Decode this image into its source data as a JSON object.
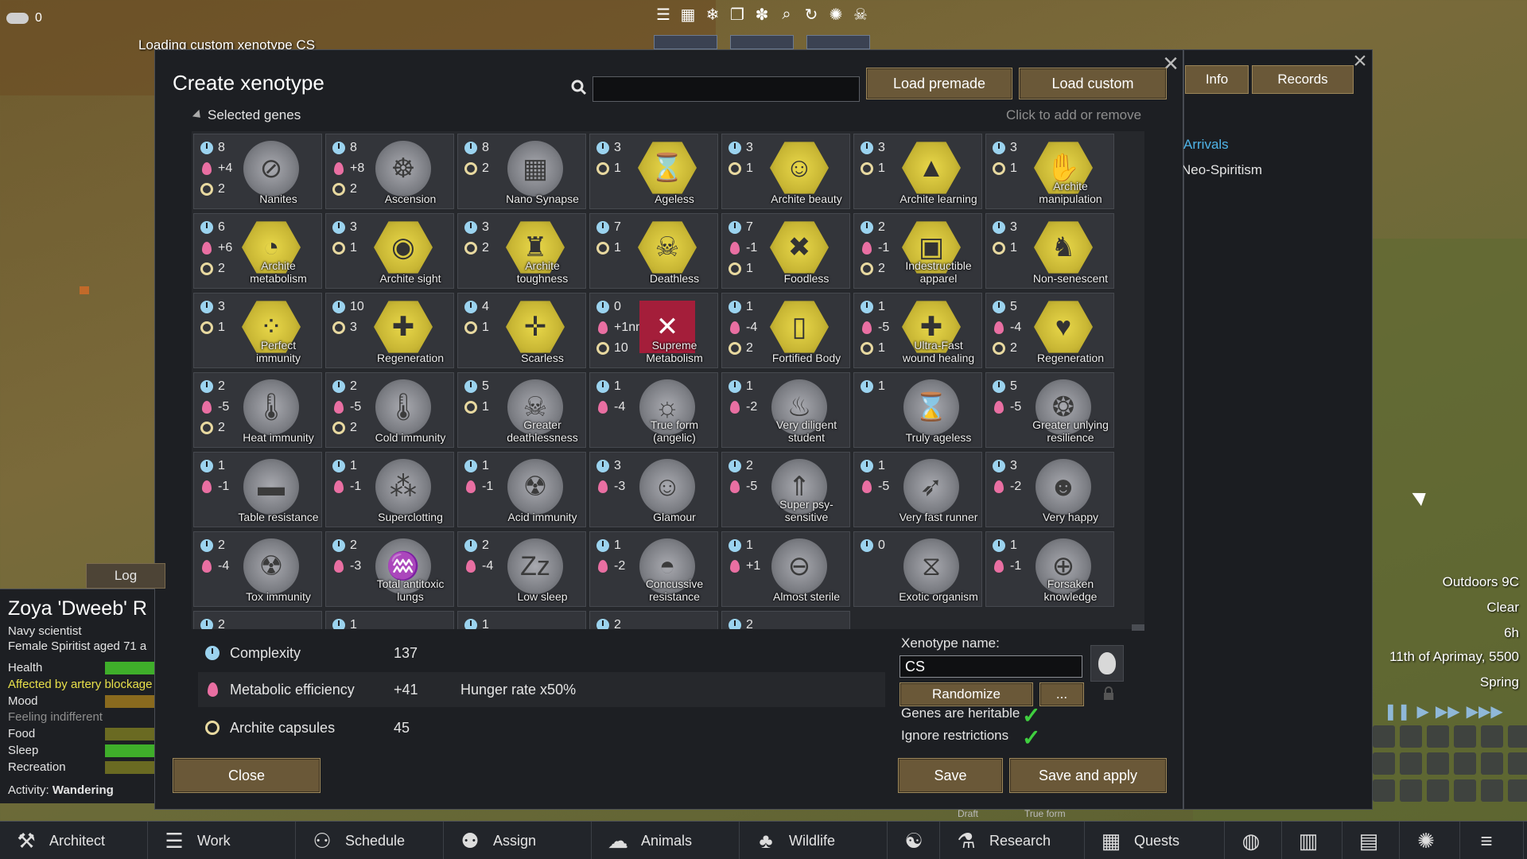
{
  "hud": {
    "silver_count": "0",
    "loading_message": "Loading custom xenotype CS"
  },
  "dialog": {
    "title": "Create xenotype",
    "search_value": "",
    "load_premade": "Load premade",
    "load_custom": "Load custom",
    "selected_genes_label": "Selected genes",
    "click_hint": "Click to add or remove",
    "genes": [
      {
        "cx": "8",
        "met": "+4",
        "arc": "2",
        "name": "Nanites",
        "icon": "nanites-icon",
        "style": "grey",
        "glyph": "⊘"
      },
      {
        "cx": "8",
        "met": "+8",
        "arc": "2",
        "name": "Ascension",
        "icon": "ascension-icon",
        "style": "grey",
        "glyph": "☸"
      },
      {
        "cx": "8",
        "met": "",
        "arc": "2",
        "name": "Nano Synapse",
        "icon": "nano-synapse-icon",
        "style": "grey",
        "glyph": "▦"
      },
      {
        "cx": "3",
        "met": "",
        "arc": "1",
        "name": "Ageless",
        "icon": "hourglass-icon",
        "style": "gold",
        "glyph": "⌛"
      },
      {
        "cx": "3",
        "met": "",
        "arc": "1",
        "name": "Archite beauty",
        "icon": "archite-beauty-icon",
        "style": "gold",
        "glyph": "☺"
      },
      {
        "cx": "3",
        "met": "",
        "arc": "1",
        "name": "Archite learning",
        "icon": "archite-learning-icon",
        "style": "gold",
        "glyph": "▲"
      },
      {
        "cx": "3",
        "met": "",
        "arc": "1",
        "name": "Archite manipulation",
        "icon": "hand-icon",
        "style": "gold",
        "glyph": "✋"
      },
      {
        "cx": "6",
        "met": "+6",
        "arc": "2",
        "name": "Archite metabolism",
        "icon": "stomach-icon",
        "style": "gold",
        "glyph": "◔"
      },
      {
        "cx": "3",
        "met": "",
        "arc": "1",
        "name": "Archite sight",
        "icon": "eye-icon",
        "style": "gold",
        "glyph": "◉"
      },
      {
        "cx": "3",
        "met": "",
        "arc": "2",
        "name": "Archite toughness",
        "icon": "tower-icon",
        "style": "gold",
        "glyph": "♜"
      },
      {
        "cx": "7",
        "met": "",
        "arc": "1",
        "name": "Deathless",
        "icon": "skull-icon",
        "style": "gold",
        "glyph": "☠"
      },
      {
        "cx": "7",
        "met": "-1",
        "arc": "1",
        "name": "Foodless",
        "icon": "foodless-icon",
        "style": "gold",
        "glyph": "✖"
      },
      {
        "cx": "2",
        "met": "-1",
        "arc": "2",
        "name": "Indestructible apparel",
        "icon": "apparel-icon",
        "style": "gold",
        "glyph": "▣"
      },
      {
        "cx": "3",
        "met": "",
        "arc": "1",
        "name": "Non-senescent",
        "icon": "non-senescent-icon",
        "style": "gold",
        "glyph": "♞"
      },
      {
        "cx": "3",
        "met": "",
        "arc": "1",
        "name": "Perfect immunity",
        "icon": "immunity-icon",
        "style": "gold",
        "glyph": "⁘"
      },
      {
        "cx": "10",
        "met": "",
        "arc": "3",
        "name": "Regeneration",
        "icon": "regeneration-icon",
        "style": "gold",
        "glyph": "✚"
      },
      {
        "cx": "4",
        "met": "",
        "arc": "1",
        "name": "Scarless",
        "icon": "scarless-icon",
        "style": "gold",
        "glyph": "✛"
      },
      {
        "cx": "0",
        "met": "+1nn",
        "arc": "10",
        "name": "Supreme Metabolism",
        "icon": "supreme-metabolism-icon",
        "style": "red",
        "glyph": "✕"
      },
      {
        "cx": "1",
        "met": "-4",
        "arc": "2",
        "name": "Fortified Body",
        "icon": "fortified-body-icon",
        "style": "gold",
        "glyph": "▯"
      },
      {
        "cx": "1",
        "met": "-5",
        "arc": "1",
        "name": "Ultra-Fast wound healing",
        "icon": "wound-healing-icon",
        "style": "gold",
        "glyph": "✚"
      },
      {
        "cx": "5",
        "met": "-4",
        "arc": "2",
        "name": "Regeneration",
        "icon": "heart-plus-icon",
        "style": "gold",
        "glyph": "♥"
      },
      {
        "cx": "2",
        "met": "-5",
        "arc": "2",
        "name": "Heat immunity",
        "icon": "heat-thermometer-icon",
        "style": "grey",
        "glyph": "🌡"
      },
      {
        "cx": "2",
        "met": "-5",
        "arc": "2",
        "name": "Cold immunity",
        "icon": "cold-thermometer-icon",
        "style": "grey",
        "glyph": "🌡"
      },
      {
        "cx": "5",
        "met": "",
        "arc": "1",
        "name": "Greater deathlessness",
        "icon": "greater-deathless-icon",
        "style": "grey",
        "glyph": "☠"
      },
      {
        "cx": "1",
        "met": "-4",
        "arc": "",
        "name": "True form (angelic)",
        "icon": "angel-icon",
        "style": "grey",
        "glyph": "☼"
      },
      {
        "cx": "1",
        "met": "-2",
        "arc": "",
        "name": "Very diligent student",
        "icon": "flame-icon",
        "style": "grey",
        "glyph": "♨"
      },
      {
        "cx": "1",
        "met": "",
        "arc": "",
        "name": "Truly ageless",
        "icon": "truly-ageless-icon",
        "style": "grey",
        "glyph": "⌛"
      },
      {
        "cx": "5",
        "met": "-5",
        "arc": "",
        "name": "Greater unlying resilience",
        "icon": "resilience-icon",
        "style": "grey",
        "glyph": "❂"
      },
      {
        "cx": "1",
        "met": "-1",
        "arc": "",
        "name": "Table resistance",
        "icon": "table-icon",
        "style": "grey",
        "glyph": "▬"
      },
      {
        "cx": "1",
        "met": "-1",
        "arc": "",
        "name": "Superclotting",
        "icon": "clotting-icon",
        "style": "grey",
        "glyph": "⁂"
      },
      {
        "cx": "1",
        "met": "-1",
        "arc": "",
        "name": "Acid immunity",
        "icon": "acid-icon",
        "style": "grey",
        "glyph": "☢"
      },
      {
        "cx": "3",
        "met": "-3",
        "arc": "",
        "name": "Glamour",
        "icon": "glamour-icon",
        "style": "grey",
        "glyph": "☺"
      },
      {
        "cx": "2",
        "met": "-5",
        "arc": "",
        "name": "Super psy-sensitive",
        "icon": "psy-sensitive-icon",
        "style": "grey",
        "glyph": "⇑"
      },
      {
        "cx": "1",
        "met": "-5",
        "arc": "",
        "name": "Very fast runner",
        "icon": "runner-icon",
        "style": "grey",
        "glyph": "➶"
      },
      {
        "cx": "3",
        "met": "-2",
        "arc": "",
        "name": "Very happy",
        "icon": "happy-face-icon",
        "style": "grey",
        "glyph": "☻"
      },
      {
        "cx": "2",
        "met": "-4",
        "arc": "",
        "name": "Tox immunity",
        "icon": "radiation-icon",
        "style": "grey",
        "glyph": "☢"
      },
      {
        "cx": "2",
        "met": "-3",
        "arc": "",
        "name": "Total antitoxic lungs",
        "icon": "lungs-icon",
        "style": "grey",
        "glyph": "♒"
      },
      {
        "cx": "2",
        "met": "-4",
        "arc": "",
        "name": "Low sleep",
        "icon": "sleep-icon",
        "style": "grey",
        "glyph": "Zz"
      },
      {
        "cx": "1",
        "met": "-2",
        "arc": "",
        "name": "Concussive resistance",
        "icon": "concussive-icon",
        "style": "grey",
        "glyph": "◓"
      },
      {
        "cx": "1",
        "met": "+1",
        "arc": "",
        "name": "Almost sterile",
        "icon": "sterile-icon",
        "style": "grey",
        "glyph": "⊖"
      },
      {
        "cx": "0",
        "met": "",
        "arc": "",
        "name": "Exotic organism",
        "icon": "dna-icon",
        "style": "grey",
        "glyph": "⧖"
      },
      {
        "cx": "1",
        "met": "-1",
        "arc": "",
        "name": "Forsaken knowledge",
        "icon": "forsaken-icon",
        "style": "grey",
        "glyph": "⊕"
      }
    ],
    "partial_row": [
      {
        "cx": "2"
      },
      {
        "cx": "1"
      },
      {
        "cx": "1"
      },
      {
        "cx": "2"
      },
      {
        "cx": "2"
      }
    ],
    "stats": {
      "complexity_label": "Complexity",
      "complexity_value": "137",
      "metabolic_label": "Metabolic efficiency",
      "metabolic_value": "+41",
      "hunger_text": "Hunger rate x50%",
      "archite_label": "Archite capsules",
      "archite_value": "45"
    },
    "xenotype_name_label": "Xenotype name:",
    "xenotype_name_value": "CS",
    "randomize": "Randomize",
    "more": "...",
    "genes_heritable": "Genes are heritable",
    "ignore_restrictions": "Ignore restrictions",
    "close": "Close",
    "save": "Save",
    "save_and_apply": "Save and apply"
  },
  "back_window": {
    "tab_info": "Info",
    "tab_records": "Records",
    "arrivals": "Arrivals",
    "ideo": "Neo-Spiritism"
  },
  "pawn": {
    "log_tab": "Log",
    "name": "Zoya 'Dweeb' R",
    "title": "Navy scientist",
    "desc": "Female Spiritist aged 71 a",
    "health": "Health",
    "health_note": "Affected by artery blockage",
    "mood": "Mood",
    "mood_note": "Feeling indifferent",
    "food": "Food",
    "sleep": "Sleep",
    "recreation": "Recreation",
    "activity_label": "Activity:",
    "activity": "Wandering"
  },
  "world_info": {
    "outdoors": "Outdoors 9C",
    "weather": "Clear",
    "hour": "6h",
    "date": "11th of Aprimay, 5500",
    "season": "Spring",
    "draft_label": "Draft",
    "true_form_label": "True form"
  },
  "bottom_bar": [
    {
      "label": "Architect",
      "icon": "hammer-icon",
      "glyph": "⚒"
    },
    {
      "label": "Work",
      "icon": "work-icon",
      "glyph": "☰"
    },
    {
      "label": "Schedule",
      "icon": "schedule-icon",
      "glyph": "⚇"
    },
    {
      "label": "Assign",
      "icon": "assign-icon",
      "glyph": "⚉"
    },
    {
      "label": "Animals",
      "icon": "animals-icon",
      "glyph": "☁"
    },
    {
      "label": "Wildlife",
      "icon": "wildlife-icon",
      "glyph": "♣"
    },
    {
      "label": "",
      "icon": "ideology-icon",
      "glyph": "☯"
    },
    {
      "label": "Research",
      "icon": "flask-icon",
      "glyph": "⚗"
    },
    {
      "label": "Quests",
      "icon": "calendar-icon",
      "glyph": "▦"
    },
    {
      "label": "",
      "icon": "world-icon",
      "glyph": "◍"
    },
    {
      "label": "",
      "icon": "history-icon",
      "glyph": "▥"
    },
    {
      "label": "",
      "icon": "factions-icon",
      "glyph": "▤"
    },
    {
      "label": "",
      "icon": "ideas-icon",
      "glyph": "✺"
    },
    {
      "label": "",
      "icon": "menu-icon",
      "glyph": "≡"
    }
  ],
  "colors": {
    "gold_button": "#6a5838",
    "accent_blue": "#4fb4e8",
    "check_green": "#3fcf3f"
  }
}
